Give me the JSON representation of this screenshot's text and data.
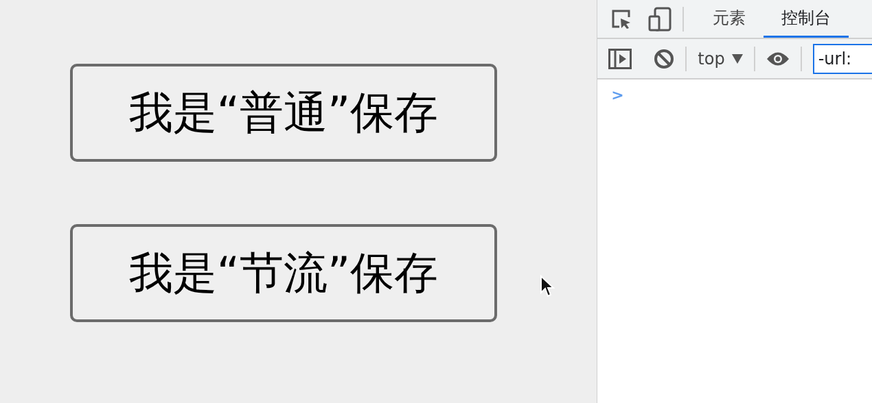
{
  "page": {
    "buttons": [
      {
        "label": "我是“普通”保存"
      },
      {
        "label": "我是“节流”保存"
      }
    ]
  },
  "devtools": {
    "tabs": [
      {
        "label": "元素",
        "selected": false
      },
      {
        "label": "控制台",
        "selected": true
      }
    ],
    "toolbar": {
      "context": "top",
      "filter": {
        "value": "-url:"
      }
    },
    "console": {
      "prompt": ">"
    }
  }
}
